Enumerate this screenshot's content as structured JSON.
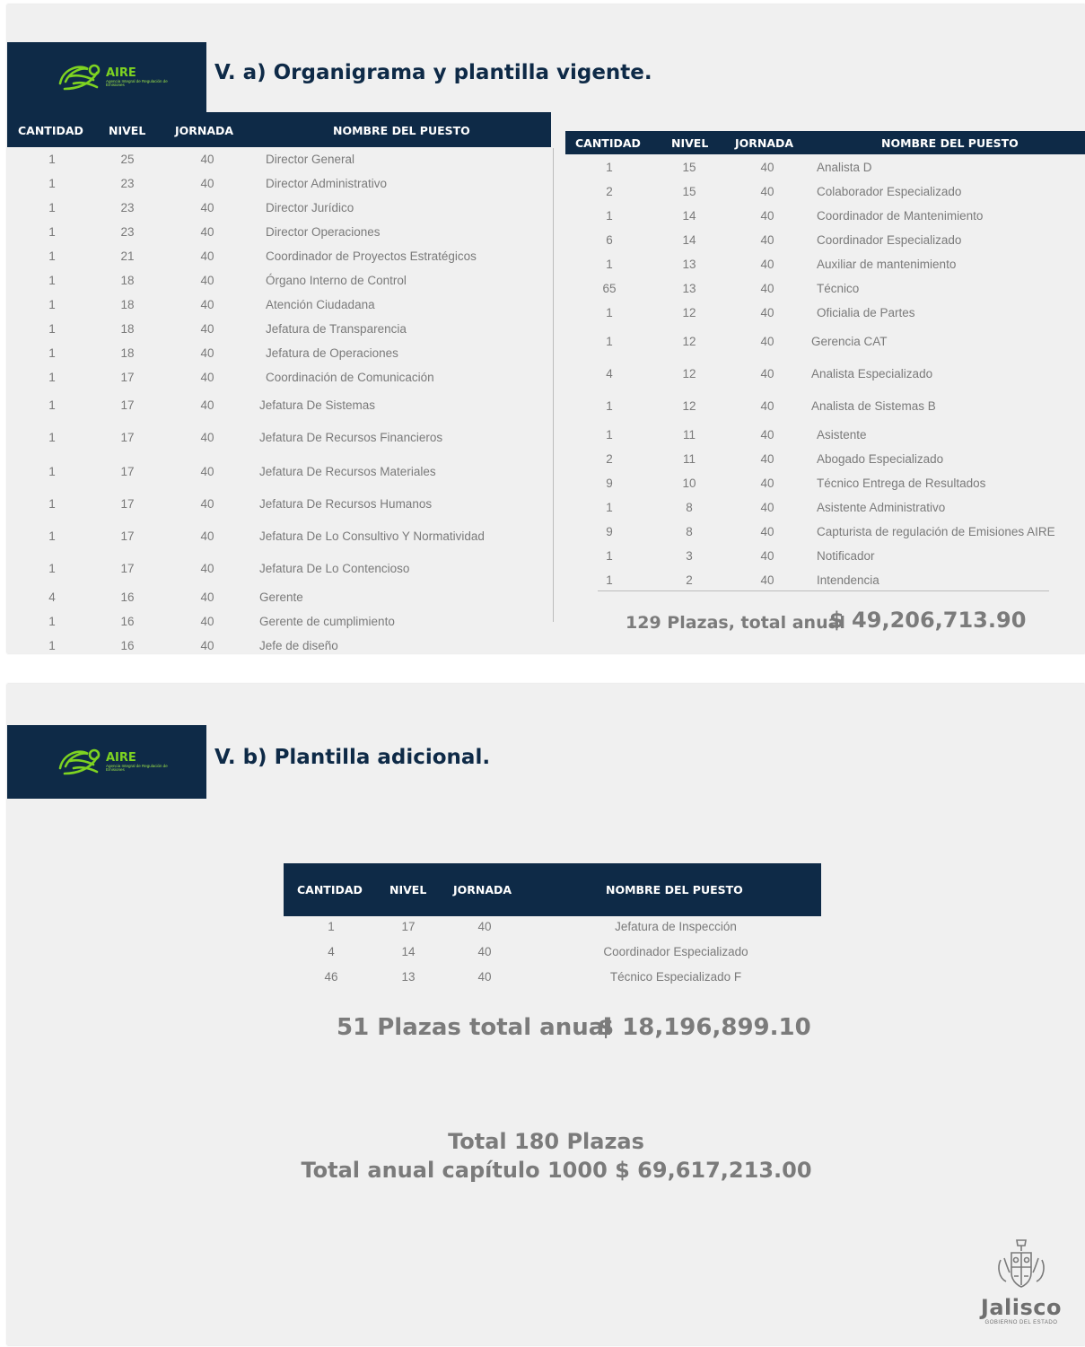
{
  "logo": {
    "name": "AIRE",
    "tagline": "Agencia Integral de Regulación de Emisiones"
  },
  "slide1": {
    "title": "V. a) Organigrama y plantilla vigente.",
    "headers": [
      "CANTIDAD",
      "NIVEL",
      "JORNADA",
      "NOMBRE DEL PUESTO"
    ],
    "left_rows": [
      [
        "1",
        "25",
        "40",
        "Director General"
      ],
      [
        "1",
        "23",
        "40",
        "Director Administrativo"
      ],
      [
        "1",
        "23",
        "40",
        "Director Jurídico"
      ],
      [
        "1",
        "23",
        "40",
        "Director Operaciones"
      ],
      [
        "1",
        "21",
        "40",
        "Coordinador de Proyectos Estratégicos"
      ],
      [
        "1",
        "18",
        "40",
        "Órgano Interno de Control"
      ],
      [
        "1",
        "18",
        "40",
        "Atención Ciudadana"
      ],
      [
        "1",
        "18",
        "40",
        "Jefatura de Transparencia"
      ],
      [
        "1",
        "18",
        "40",
        "Jefatura de Operaciones"
      ],
      [
        "1",
        "17",
        "40",
        "Coordinación de Comunicación"
      ],
      [
        "1",
        "17",
        "40",
        "Jefatura De Sistemas"
      ],
      [
        "1",
        "17",
        "40",
        "Jefatura De Recursos Financieros"
      ],
      [
        "1",
        "17",
        "40",
        "Jefatura De Recursos Materiales"
      ],
      [
        "1",
        "17",
        "40",
        "Jefatura De Recursos Humanos"
      ],
      [
        "1",
        "17",
        "40",
        "Jefatura De Lo Consultivo Y Normatividad"
      ],
      [
        "1",
        "17",
        "40",
        "Jefatura De Lo Contencioso"
      ],
      [
        "4",
        "16",
        "40",
        "Gerente"
      ],
      [
        "1",
        "16",
        "40",
        "Gerente de cumplimiento"
      ],
      [
        "1",
        "16",
        "40",
        "Jefe de diseño"
      ]
    ],
    "right_rows": [
      [
        "1",
        "15",
        "40",
        "Analista D"
      ],
      [
        "2",
        "15",
        "40",
        "Colaborador Especializado"
      ],
      [
        "1",
        "14",
        "40",
        "Coordinador de Mantenimiento"
      ],
      [
        "6",
        "14",
        "40",
        "Coordinador Especializado"
      ],
      [
        "1",
        "13",
        "40",
        "Auxiliar de mantenimiento"
      ],
      [
        "65",
        "13",
        "40",
        "Técnico"
      ],
      [
        "1",
        "12",
        "40",
        "Oficialia de Partes"
      ],
      [
        "1",
        "12",
        "40",
        "Gerencia CAT"
      ],
      [
        "4",
        "12",
        "40",
        "Analista Especializado"
      ],
      [
        "1",
        "12",
        "40",
        "Analista de Sistemas B"
      ],
      [
        "1",
        "11",
        "40",
        "Asistente"
      ],
      [
        "2",
        "11",
        "40",
        "Abogado Especializado"
      ],
      [
        "9",
        "10",
        "40",
        "Técnico Entrega de Resultados"
      ],
      [
        "1",
        "8",
        "40",
        "Asistente Administrativo"
      ],
      [
        "9",
        "8",
        "40",
        "Capturista de regulación de Emisiones AIRE"
      ],
      [
        "1",
        "3",
        "40",
        "Notificador"
      ],
      [
        "1",
        "2",
        "40",
        "Intendencia"
      ]
    ],
    "total_label": "129 Plazas, total anual",
    "total_amount": "$ 49,206,713.90"
  },
  "slide2": {
    "title": "V. b) Plantilla adicional.",
    "headers": [
      "CANTIDAD",
      "NIVEL",
      "JORNADA",
      "NOMBRE DEL PUESTO"
    ],
    "rows": [
      [
        "1",
        "17",
        "40",
        "Jefatura de Inspección"
      ],
      [
        "4",
        "14",
        "40",
        "Coordinador Especializado"
      ],
      [
        "46",
        "13",
        "40",
        "Técnico Especializado F"
      ]
    ],
    "total_label": "51 Plazas total anual",
    "total_amount": "$ 18,196,899.10",
    "grand_total_1": "Total 180 Plazas",
    "grand_total_2": "Total anual capítulo 1000  $ 69,617,213.00"
  },
  "seal": {
    "name": "Jalisco",
    "sub": "GOBIERNO DEL ESTADO"
  }
}
